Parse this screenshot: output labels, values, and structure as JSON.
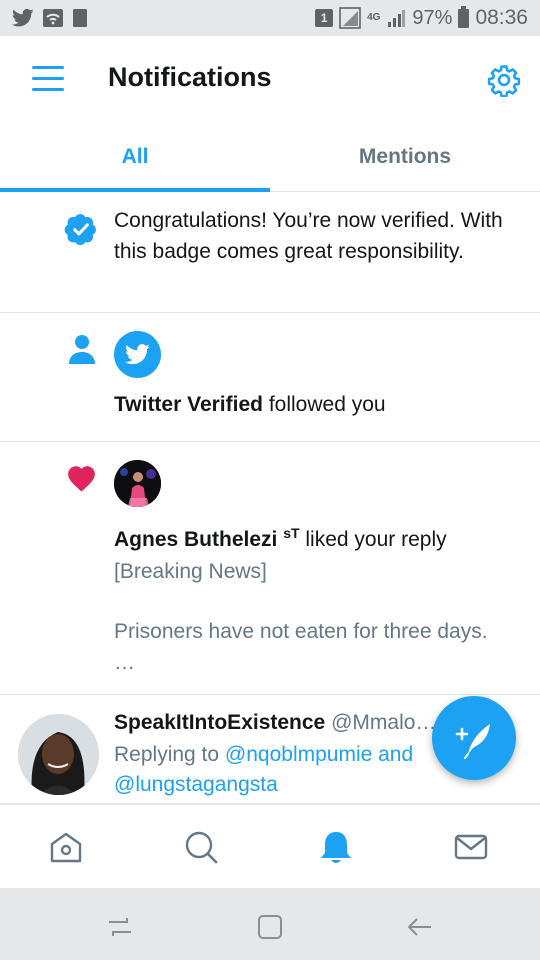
{
  "status_bar": {
    "battery": "97%",
    "time": "08:36",
    "network_type": "4G",
    "sim_slot": "1"
  },
  "header": {
    "title": "Notifications"
  },
  "tabs": [
    {
      "label": "All",
      "active": true
    },
    {
      "label": "Mentions",
      "active": false
    }
  ],
  "notifications": [
    {
      "type": "verified",
      "icon": "verified-badge-icon",
      "text": "Congratulations! You’re now verified. With this badge comes great responsibility."
    },
    {
      "type": "follow",
      "icon": "person-icon",
      "actor": "Twitter Verified",
      "action": "followed you"
    },
    {
      "type": "like",
      "icon": "heart-icon",
      "actor": "Agnes Buthelezi",
      "actor_suffix": "sT",
      "action": "liked your reply",
      "preview_line1": "[Breaking News]",
      "preview_line2": "Prisoners have not eaten for three days. …"
    },
    {
      "type": "mention",
      "name": "SpeakItIntoExistence",
      "handle": "@Mmalo…",
      "replying_to": "Replying to",
      "mention1": "@nqoblmpumie and",
      "mention2": "@lungstagangsta"
    }
  ],
  "colors": {
    "accent": "#1da1f2",
    "heart": "#e0245e",
    "muted_text": "#657786",
    "divider": "#e1e8ed"
  }
}
